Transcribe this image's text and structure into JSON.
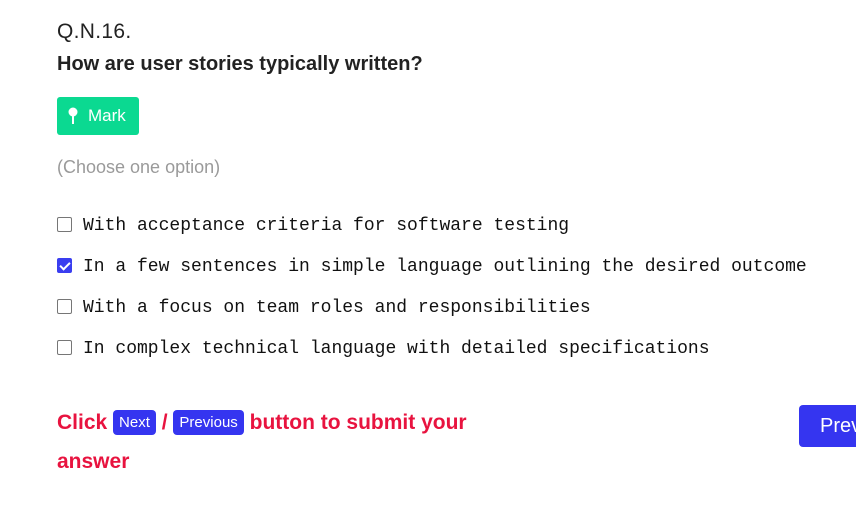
{
  "question": {
    "number": "Q.N.16.",
    "title": "How are user stories typically written?",
    "mark_label": "Mark",
    "hint": "(Choose one option)"
  },
  "options": [
    {
      "label": "With acceptance criteria for software testing",
      "checked": false
    },
    {
      "label": "In a few sentences in simple language outlining the desired outcome",
      "checked": true
    },
    {
      "label": "With a focus on team roles and responsibilities",
      "checked": false
    },
    {
      "label": "In complex technical language with detailed specifications",
      "checked": false
    }
  ],
  "instruction": {
    "prefix": "Click",
    "next_label": "Next",
    "separator": "/",
    "previous_label": "Previous",
    "suffix": "button to submit your answer"
  },
  "nav": {
    "previous_button": "Previous"
  },
  "colors": {
    "mark_green": "#0bd991",
    "accent_blue": "#3535f0",
    "instruction_red": "#e8133f"
  },
  "icons": {
    "mark": "pin-icon",
    "option": "checkbox-icon"
  }
}
